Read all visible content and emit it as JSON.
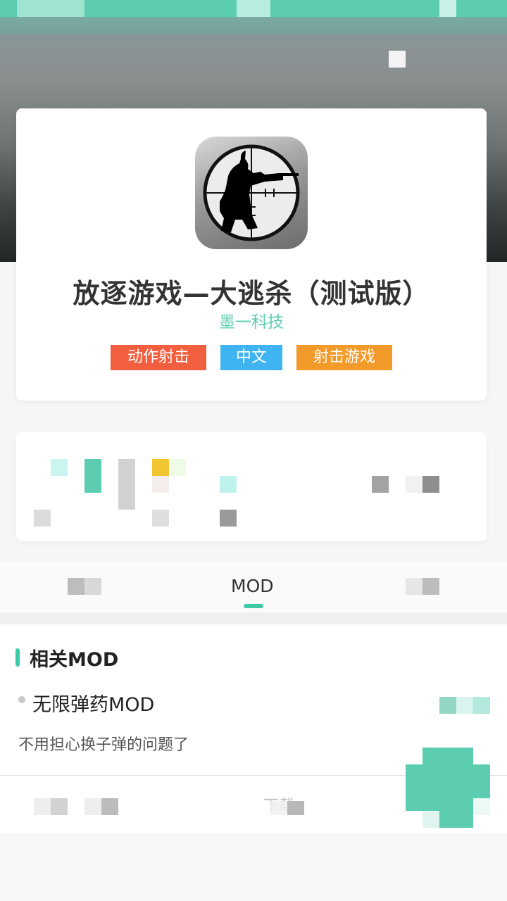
{
  "app": {
    "title": "放逐游戏—大逃杀（测试版）",
    "developer": "墨一科技",
    "tags": [
      "动作射击",
      "中文",
      "射击游戏"
    ],
    "icon": "sniper-crosshair-icon"
  },
  "tabs": {
    "mod_label": "MOD"
  },
  "mod_section": {
    "title": "相关MOD",
    "items": [
      {
        "name": "无限弹药MOD",
        "description": "不用担心换子弹的问题了"
      }
    ],
    "download_label": "下载"
  },
  "colors": {
    "accent": "#3ec9a7",
    "developer_text": "#5ecdb1",
    "tag_action": "#f15f3f",
    "tag_chinese": "#40b4f0",
    "tag_shooter": "#f39b2a"
  }
}
